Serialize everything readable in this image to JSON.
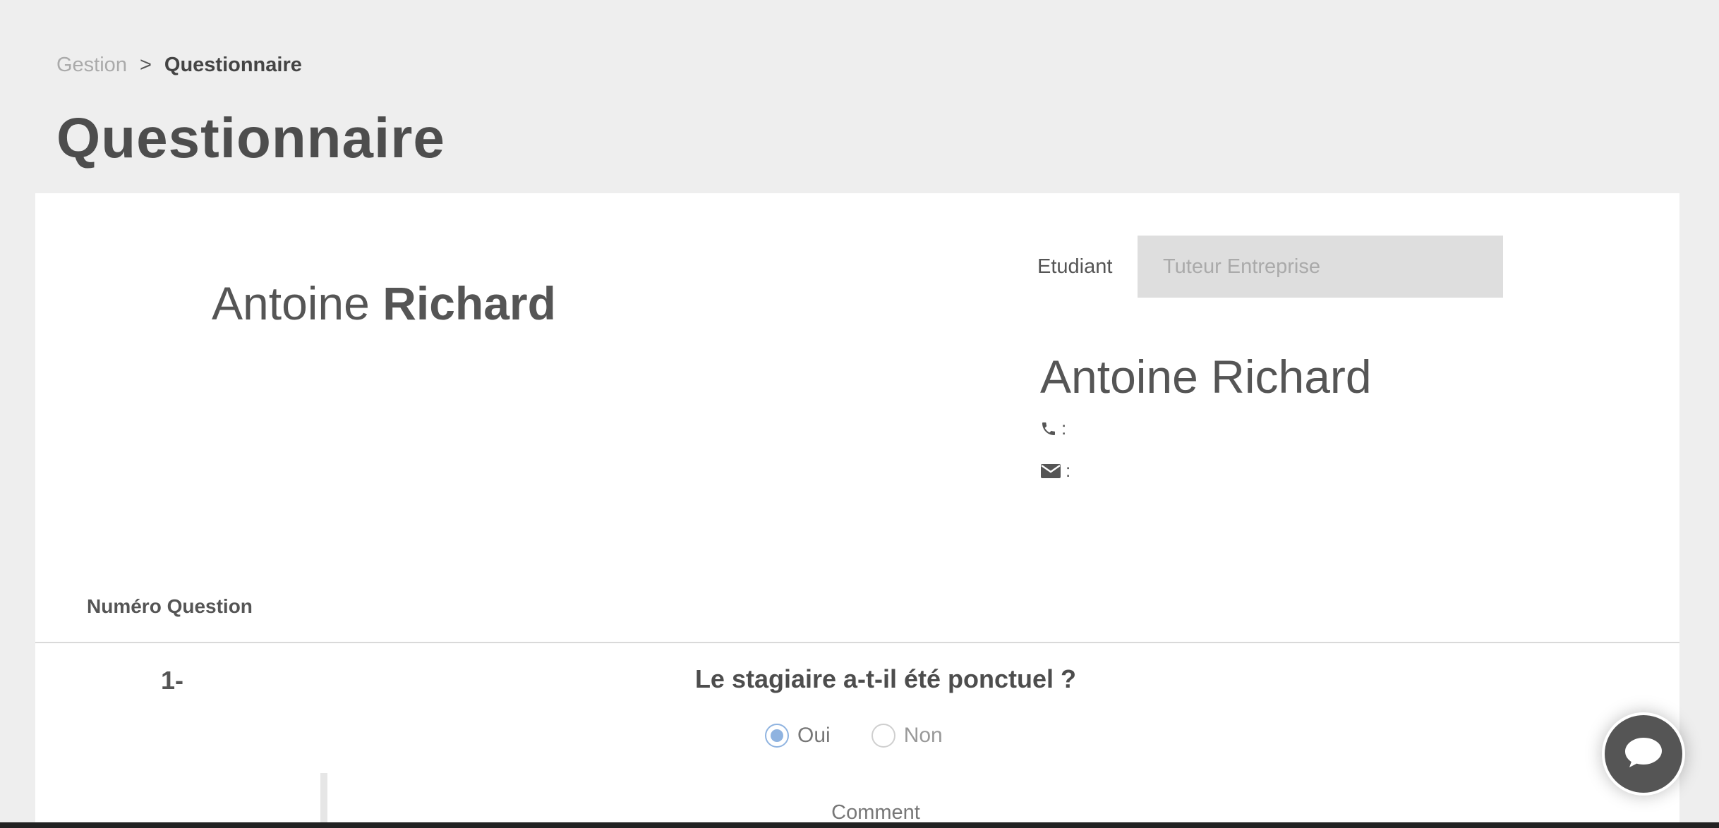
{
  "breadcrumb": {
    "parent": "Gestion",
    "separator": ">",
    "current": "Questionnaire"
  },
  "page": {
    "title": "Questionnaire"
  },
  "student": {
    "first_name": "Antoine",
    "last_name": "Richard"
  },
  "tabs": [
    {
      "label": "Etudiant",
      "active": true
    },
    {
      "label": "Tuteur Entreprise",
      "active": false
    }
  ],
  "contact": {
    "name": "Antoine Richard",
    "phone_label": ":",
    "email_label": ":",
    "phone_icon": "phone-icon",
    "email_icon": "envelope-icon"
  },
  "questions": {
    "header": "Numéro Question",
    "items": [
      {
        "number": "1-",
        "text": "Le stagiaire a-t-il été ponctuel ?",
        "options": [
          {
            "label": "Oui",
            "selected": true
          },
          {
            "label": "Non",
            "selected": false
          }
        ],
        "comment_label": "Comment"
      }
    ]
  },
  "chat": {
    "icon": "chat-bubble-icon"
  },
  "colors": {
    "accent": "#8fb3e0",
    "background": "#eeeeee",
    "card": "#ffffff",
    "tab_inactive": "#dedede"
  }
}
